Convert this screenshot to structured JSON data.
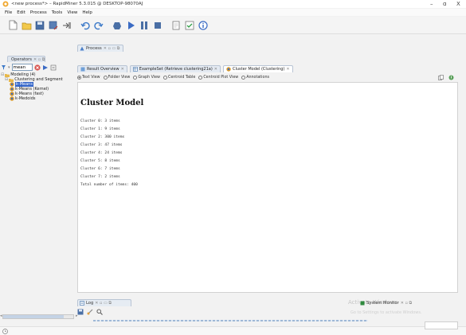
{
  "window": {
    "title": "<new process*> – RapidMiner 5.3.015 @ DESKTOP-98070AJ",
    "minimize": "–",
    "maximize": "ɑ",
    "close": "X"
  },
  "menu": [
    "File",
    "Edit",
    "Process",
    "Tools",
    "View",
    "Help"
  ],
  "toolbar": {
    "buttons": [
      "new-icon",
      "open-icon",
      "save-icon",
      "save-as-icon",
      "export-icon",
      "undo-icon",
      "redo-icon",
      "stop-icon",
      "run-icon",
      "pause-icon",
      "terminate-icon",
      "wizard-icon",
      "validate-icon",
      "info-icon"
    ]
  },
  "operators_panel": {
    "tab_label": "Operators",
    "search_value": "mean",
    "tree": [
      {
        "label": "Modeling (4)",
        "level": 0,
        "icon": "folder-icon"
      },
      {
        "label": "Clustering and Segment",
        "level": 1,
        "icon": "folder-icon"
      },
      {
        "label": "k-Means",
        "level": 2,
        "icon": "cluster-operator-icon",
        "selected": true
      },
      {
        "label": "k-Means (Kernel)",
        "level": 2,
        "icon": "cluster-operator-icon"
      },
      {
        "label": "k-Means (fast)",
        "level": 2,
        "icon": "cluster-operator-icon"
      },
      {
        "label": "k-Medoids",
        "level": 2,
        "icon": "cluster-operator-icon"
      }
    ]
  },
  "process_panel": {
    "tab_label": "Process"
  },
  "results": {
    "tabs": [
      {
        "label": "Result Overview",
        "active": false
      },
      {
        "label": "ExampleSet (Retrieve clustering21a)",
        "active": false
      },
      {
        "label": "Cluster Model (Clustering)",
        "active": true
      }
    ],
    "views": [
      {
        "label": "Text View",
        "selected": true
      },
      {
        "label": "Folder View",
        "selected": false
      },
      {
        "label": "Graph View",
        "selected": false
      },
      {
        "label": "Centroid Table",
        "selected": false
      },
      {
        "label": "Centroid Plot View",
        "selected": false
      },
      {
        "label": "Annotations",
        "selected": false
      }
    ],
    "model_title": "Cluster Model",
    "lines": [
      "Cluster 0: 3 items",
      "Cluster 1: 9 items",
      "Cluster 2: 300 items",
      "Cluster 3: 47 items",
      "Cluster 4: 24 items",
      "Cluster 5: 8 items",
      "Cluster 6: 7 items",
      "Cluster 7: 2 items",
      "Total number of items: 400"
    ]
  },
  "log_panel": {
    "tab_label": "Log"
  },
  "system_monitor": {
    "tab_label": "System Monitor"
  },
  "watermark": {
    "line1": "Activate Windows",
    "line2": "Go to Settings to activate Windows."
  }
}
